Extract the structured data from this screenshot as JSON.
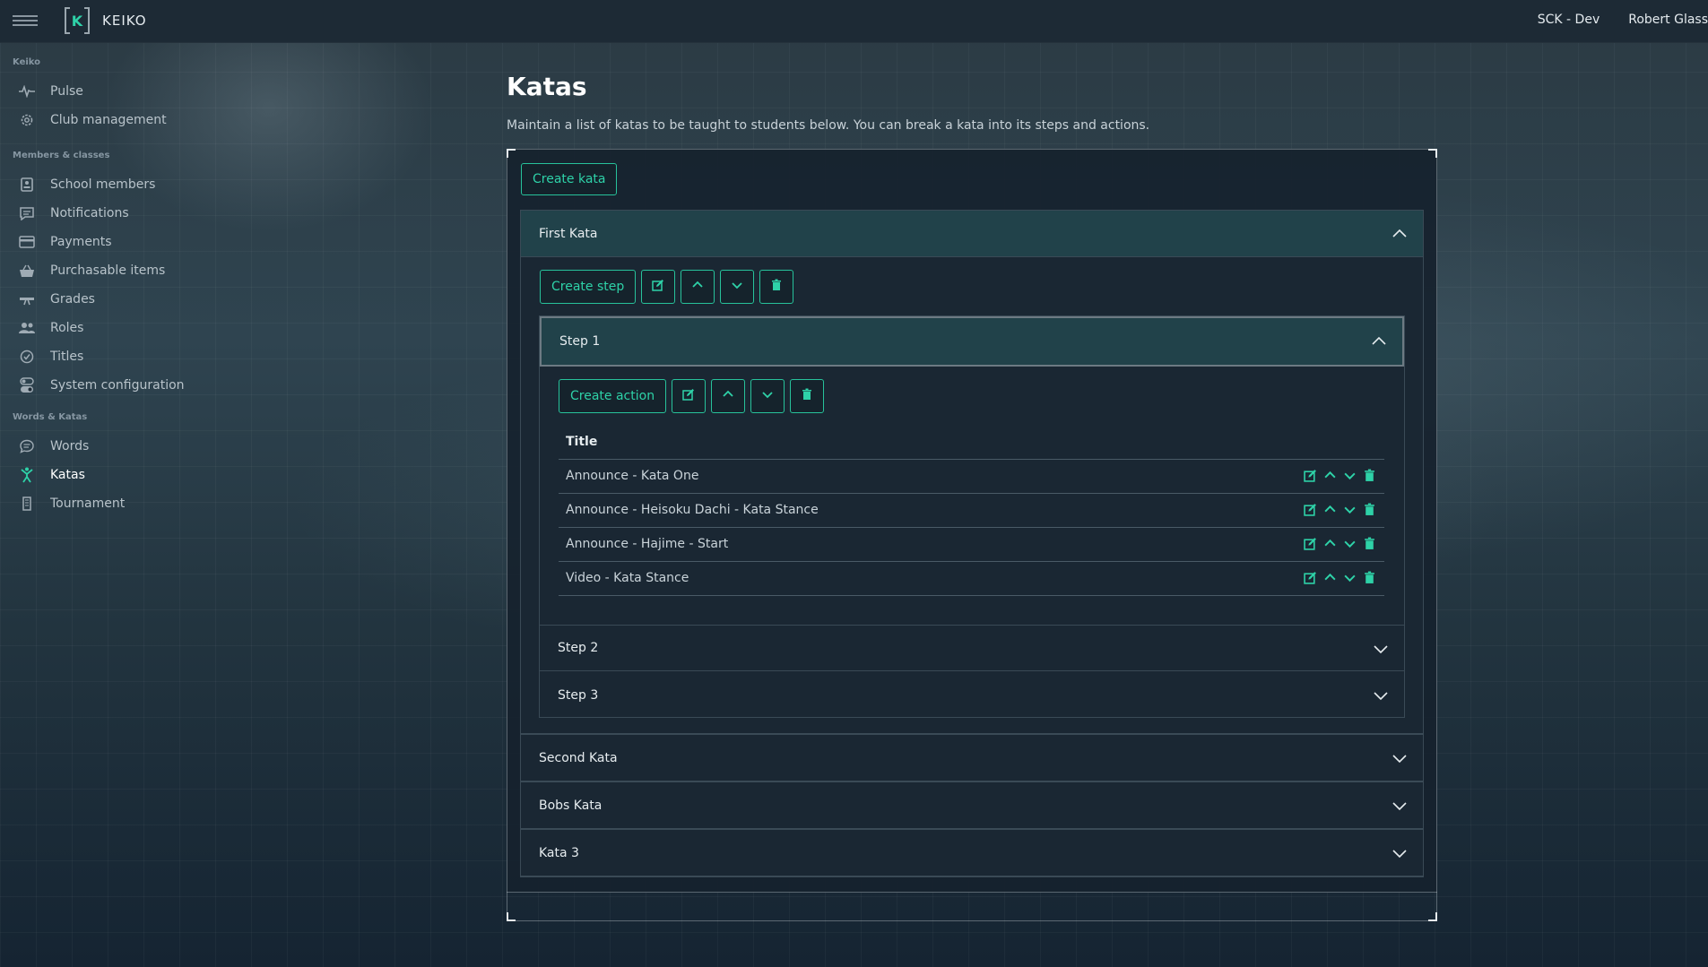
{
  "topbar": {
    "brand": "KEIKO",
    "logo_letter": "K",
    "club": "SCK - Dev",
    "user": "Robert Glass"
  },
  "sidebar": {
    "sections": [
      {
        "title": "Keiko",
        "items": [
          {
            "label": "Pulse",
            "icon": "pulse-icon"
          },
          {
            "label": "Club management",
            "icon": "gear-icon"
          }
        ]
      },
      {
        "title": "Members & classes",
        "items": [
          {
            "label": "School members",
            "icon": "id-card-icon"
          },
          {
            "label": "Notifications",
            "icon": "message-icon"
          },
          {
            "label": "Payments",
            "icon": "credit-card-icon"
          },
          {
            "label": "Purchasable items",
            "icon": "basket-icon"
          },
          {
            "label": "Grades",
            "icon": "belt-icon"
          },
          {
            "label": "Roles",
            "icon": "users-icon"
          },
          {
            "label": "Titles",
            "icon": "badge-check-icon"
          },
          {
            "label": "System configuration",
            "icon": "toggle-icon"
          }
        ]
      },
      {
        "title": "Words & Katas",
        "items": [
          {
            "label": "Words",
            "icon": "chat-icon"
          },
          {
            "label": "Katas",
            "icon": "karate-icon",
            "active": true
          },
          {
            "label": "Tournament",
            "icon": "building-icon"
          }
        ]
      }
    ]
  },
  "page": {
    "title": "Katas",
    "description": "Maintain a list of katas to be taught to students below. You can break a kata into its steps and actions.",
    "create_kata_label": "Create kata"
  },
  "katas": [
    {
      "name": "First Kata",
      "expanded": true,
      "create_step_label": "Create step",
      "steps": [
        {
          "name": "Step 1",
          "expanded": true,
          "create_action_label": "Create action",
          "table_header": "Title",
          "actions": [
            "Announce - Kata One",
            "Announce - Heisoku Dachi - Kata Stance",
            "Announce - Hajime - Start",
            "Video - Kata Stance"
          ]
        },
        {
          "name": "Step 2",
          "expanded": false
        },
        {
          "name": "Step 3",
          "expanded": false
        }
      ]
    },
    {
      "name": "Second Kata",
      "expanded": false
    },
    {
      "name": "Bobs Kata",
      "expanded": false
    },
    {
      "name": "Kata 3",
      "expanded": false
    }
  ],
  "colors": {
    "accent": "#2ed2a8",
    "topbar": "#1d2a35",
    "panel_open": "#21424a"
  }
}
